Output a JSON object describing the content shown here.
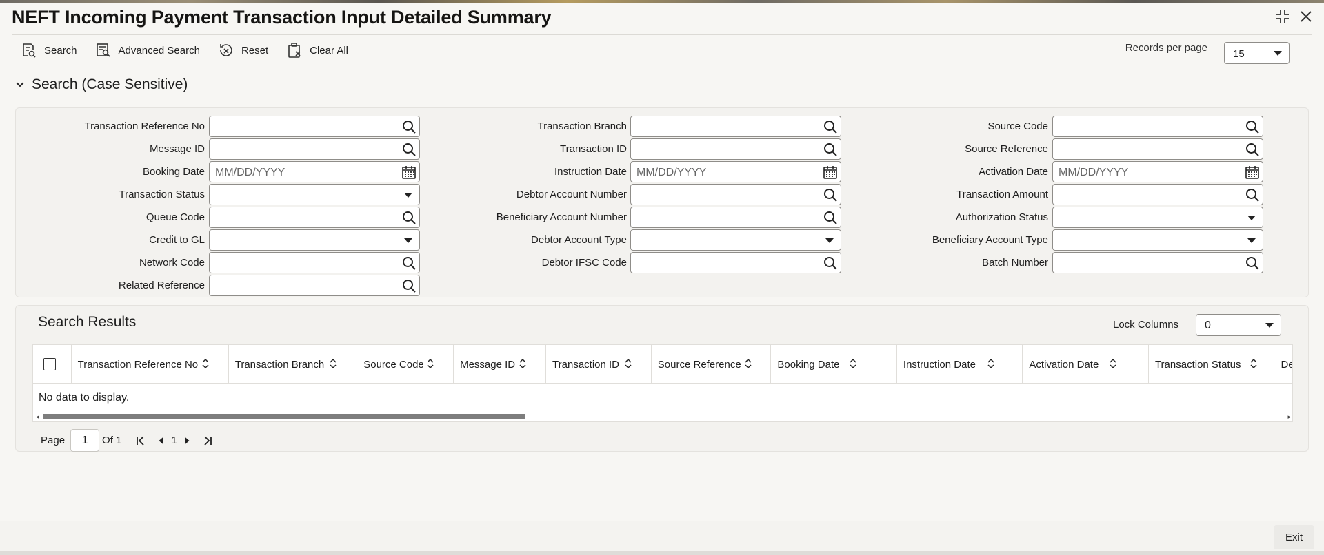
{
  "title": "NEFT Incoming Payment Transaction Input Detailed Summary",
  "window_icons": [
    "collapse-icon",
    "close-icon"
  ],
  "toolbar": {
    "search": "Search",
    "advanced_search": "Advanced Search",
    "reset": "Reset",
    "clear_all": "Clear All"
  },
  "records_per_page": {
    "label": "Records per page",
    "value": "15"
  },
  "search_section": {
    "title": "Search (Case Sensitive)",
    "col1": [
      {
        "label": "Transaction Reference No",
        "type": "lookup",
        "value": ""
      },
      {
        "label": "Message ID",
        "type": "lookup",
        "value": ""
      },
      {
        "label": "Booking Date",
        "type": "date",
        "placeholder": "MM/DD/YYYY"
      },
      {
        "label": "Transaction Status",
        "type": "select",
        "value": ""
      },
      {
        "label": "Queue Code",
        "type": "lookup",
        "value": ""
      },
      {
        "label": "Credit to GL",
        "type": "select",
        "value": ""
      },
      {
        "label": "Network Code",
        "type": "lookup",
        "value": ""
      },
      {
        "label": "Related Reference",
        "type": "lookup",
        "value": ""
      }
    ],
    "col2": [
      {
        "label": "Transaction Branch",
        "type": "lookup",
        "value": ""
      },
      {
        "label": "Transaction ID",
        "type": "lookup",
        "value": ""
      },
      {
        "label": "Instruction Date",
        "type": "date",
        "placeholder": "MM/DD/YYYY"
      },
      {
        "label": "Debtor Account Number",
        "type": "lookup",
        "value": ""
      },
      {
        "label": "Beneficiary Account Number",
        "type": "lookup",
        "value": ""
      },
      {
        "label": "Debtor Account Type",
        "type": "select",
        "value": ""
      },
      {
        "label": "Debtor IFSC Code",
        "type": "lookup",
        "value": ""
      }
    ],
    "col3": [
      {
        "label": "Source Code",
        "type": "lookup",
        "value": ""
      },
      {
        "label": "Source Reference",
        "type": "lookup",
        "value": ""
      },
      {
        "label": "Activation Date",
        "type": "date",
        "placeholder": "MM/DD/YYYY"
      },
      {
        "label": "Transaction Amount",
        "type": "lookup",
        "value": ""
      },
      {
        "label": "Authorization Status",
        "type": "select",
        "value": ""
      },
      {
        "label": "Beneficiary Account Type",
        "type": "select",
        "value": ""
      },
      {
        "label": "Batch Number",
        "type": "lookup",
        "value": ""
      }
    ]
  },
  "results": {
    "title": "Search Results",
    "lock_columns": {
      "label": "Lock Columns",
      "value": "0"
    },
    "columns": [
      "Transaction Reference No",
      "Transaction Branch",
      "Source Code",
      "Message ID",
      "Transaction ID",
      "Source Reference",
      "Booking Date",
      "Instruction Date",
      "Activation Date",
      "Transaction Status",
      "De"
    ],
    "empty_message": "No data to display.",
    "pager": {
      "page_label": "Page",
      "page_value": "1",
      "of_label": "Of 1",
      "current": "1"
    }
  },
  "footer": {
    "exit": "Exit"
  }
}
